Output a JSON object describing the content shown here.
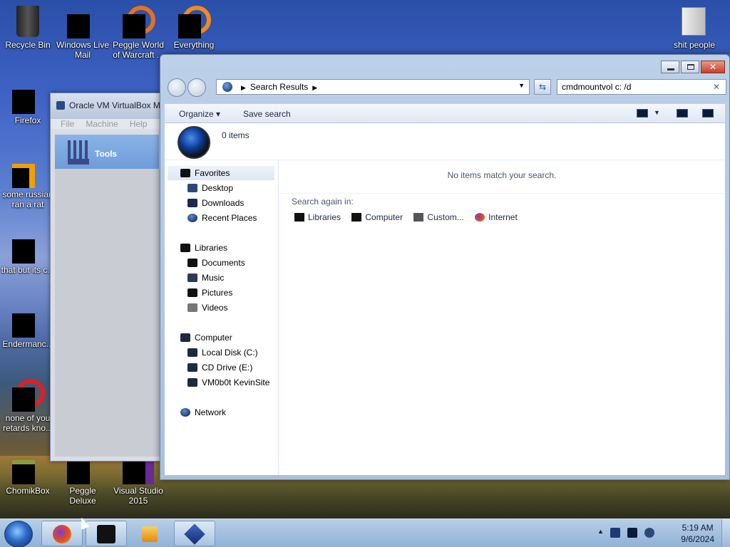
{
  "desktop": {
    "icons": [
      {
        "label": "Recycle Bin",
        "icon": "recycle-bin-icon"
      },
      {
        "label": "Windows Live Mail",
        "icon": "mail-icon"
      },
      {
        "label": "Peggle World of Warcraft ...",
        "icon": "peggle-icon"
      },
      {
        "label": "Everything",
        "icon": "everything-icon"
      },
      {
        "label": "shit people",
        "icon": "folder-icon"
      },
      {
        "label": "Firefox",
        "icon": "firefox-icon"
      },
      {
        "label": "some russian ran a rat",
        "icon": "app-icon"
      },
      {
        "label": "that but its c...",
        "icon": "app-icon"
      },
      {
        "label": "Endermanc...",
        "icon": "app-icon"
      },
      {
        "label": "none of you retards kno...",
        "icon": "app-icon"
      },
      {
        "label": "ChomikBox",
        "icon": "chomikbox-icon"
      },
      {
        "label": "Peggle Deluxe",
        "icon": "peggle-icon"
      },
      {
        "label": "Visual Studio 2015",
        "icon": "visual-studio-icon"
      }
    ]
  },
  "vbox": {
    "title": "Oracle VM VirtualBox M",
    "menu": [
      "File",
      "Machine",
      "Help"
    ],
    "tools_label": "Tools"
  },
  "explorer": {
    "address": "Search Results",
    "search_value": "cmdmountvol c: /d",
    "close_glyph": "✕",
    "toolbar": {
      "organize": "Organize ▾",
      "save_search": "Save search"
    },
    "summary_count": "0 items",
    "nav": {
      "favorites": "Favorites",
      "desktop": "Desktop",
      "downloads": "Downloads",
      "recent": "Recent Places",
      "libraries": "Libraries",
      "documents": "Documents",
      "music": "Music",
      "pictures": "Pictures",
      "videos": "Videos",
      "computer": "Computer",
      "local_disk": "Local Disk (C:)",
      "cd_drive": "CD Drive (E:)",
      "vm_share": "VM0b0t KevinSite",
      "network": "Network"
    },
    "no_match": "No items match your search.",
    "search_again": "Search again in:",
    "again_items": [
      "Libraries",
      "Computer",
      "Custom...",
      "Internet"
    ]
  },
  "taskbar": {
    "time": "5:19 AM",
    "date": "9/6/2024"
  }
}
